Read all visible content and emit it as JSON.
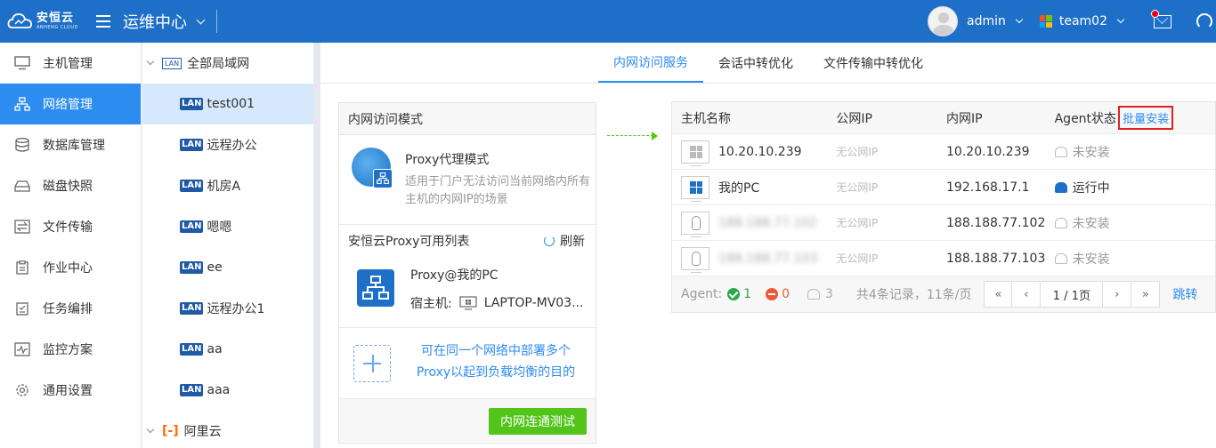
{
  "header": {
    "logo_text": "安恒云",
    "logo_sub": "ANHENG CLOUD",
    "app_title": "运维中心",
    "user": "admin",
    "team": "team02"
  },
  "leftnav": {
    "items": [
      {
        "label": "主机管理"
      },
      {
        "label": "网络管理"
      },
      {
        "label": "数据库管理"
      },
      {
        "label": "磁盘快照"
      },
      {
        "label": "文件传输"
      },
      {
        "label": "作业中心"
      },
      {
        "label": "任务编排"
      },
      {
        "label": "监控方案"
      },
      {
        "label": "通用设置"
      }
    ]
  },
  "tree": {
    "root": "全部局域网",
    "lan_tag": "LAN",
    "items": [
      "test001",
      "远程办公",
      "机房A",
      "嗯嗯",
      "ee",
      "远程办公1",
      "aa",
      "aaa"
    ],
    "aliyun": "阿里云"
  },
  "tabs": [
    "内网访问服务",
    "会话中转优化",
    "文件传输中转优化"
  ],
  "panel": {
    "head": "内网访问模式",
    "mode_title": "Proxy代理模式",
    "mode_desc": "适用于门户无法访问当前网络内所有主机的内网IP的场景",
    "list_title": "安恒云Proxy可用列表",
    "refresh": "刷新",
    "proxy_name": "Proxy@我的PC",
    "host_label": "宿主机:",
    "host_value": "LAPTOP-MV03...",
    "add_text": "可在同一个网络中部署多个Proxy以起到负载均衡的目的",
    "test_button": "内网连通测试"
  },
  "table": {
    "headers": {
      "name": "主机名称",
      "public_ip": "公网IP",
      "private_ip": "内网IP",
      "agent": "Agent状态",
      "batch": "批量安装"
    },
    "rows": [
      {
        "name": "10.20.10.239",
        "public_ip": "无公网IP",
        "private_ip": "10.20.10.239",
        "status": "未安装"
      },
      {
        "name": "我的PC",
        "public_ip": "无公网IP",
        "private_ip": "192.168.17.1",
        "status": "运行中"
      },
      {
        "name": "188.188.77.102",
        "public_ip": "无公网IP",
        "private_ip": "188.188.77.102",
        "status": "未安装"
      },
      {
        "name": "188.188.77.103",
        "public_ip": "无公网IP",
        "private_ip": "188.188.77.103",
        "status": "未安装"
      }
    ],
    "footer": {
      "agent_label": "Agent:",
      "ok_count": "1",
      "err_count": "0",
      "none_count": "3",
      "summary": "共4条记录，11条/页",
      "page": "1 / 1页",
      "jump": "跳转"
    }
  },
  "colors": {
    "primary": "#1e6fc8",
    "accent": "#2d8cf0",
    "success": "#52c41a",
    "danger": "#e02020"
  }
}
